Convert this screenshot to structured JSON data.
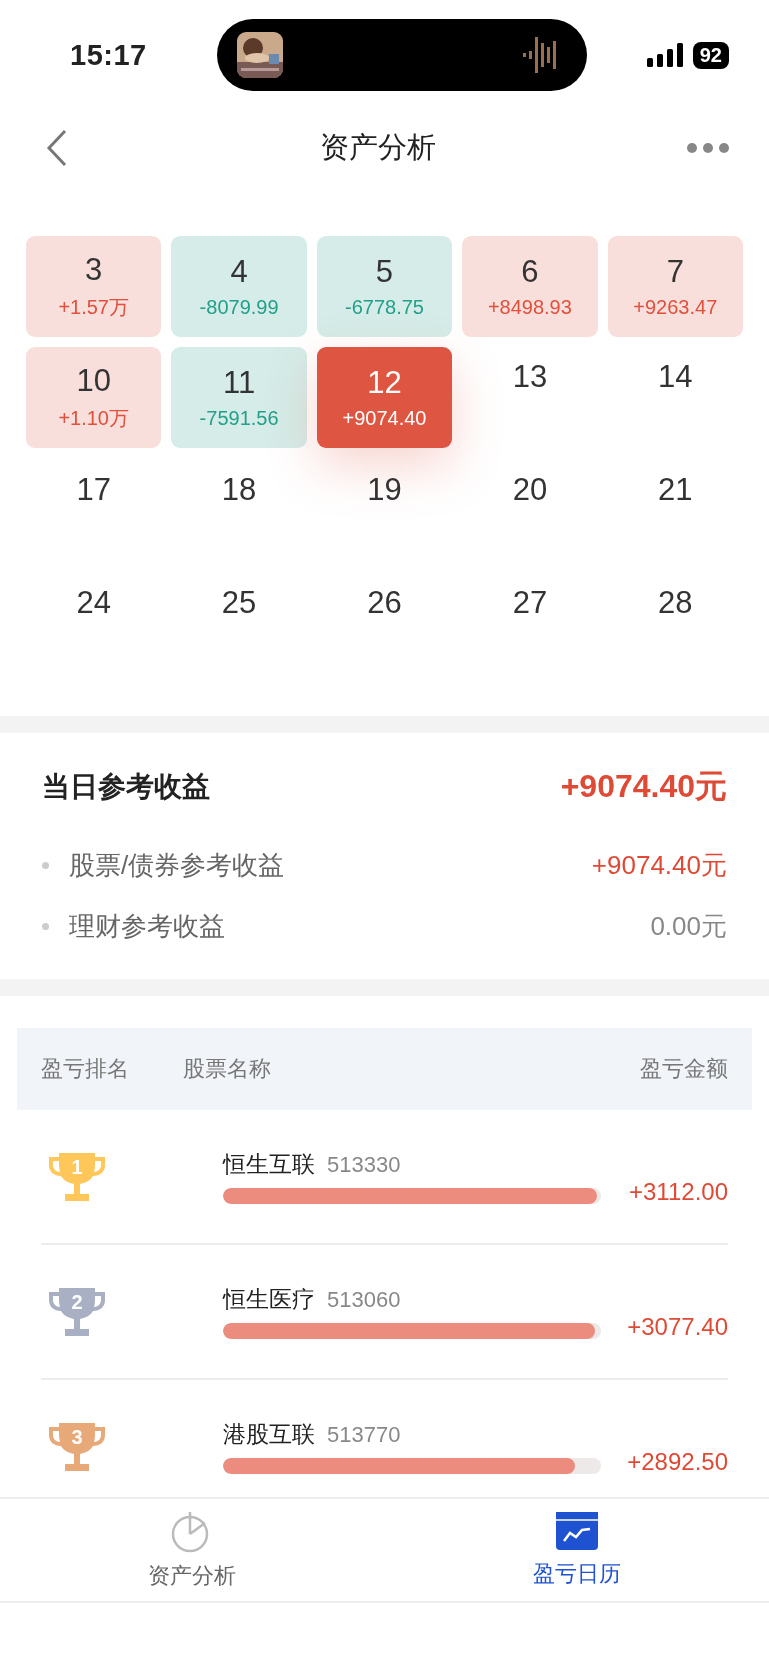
{
  "status_bar": {
    "time": "15:17",
    "battery": "92"
  },
  "nav": {
    "title": "资产分析"
  },
  "calendar": {
    "weeks": [
      [
        {
          "day": "3",
          "amount": "+1.57万",
          "kind": "gain",
          "selected": false
        },
        {
          "day": "4",
          "amount": "-8079.99",
          "kind": "loss",
          "selected": false
        },
        {
          "day": "5",
          "amount": "-6778.75",
          "kind": "loss",
          "selected": false
        },
        {
          "day": "6",
          "amount": "+8498.93",
          "kind": "gain",
          "selected": false
        },
        {
          "day": "7",
          "amount": "+9263.47",
          "kind": "gain",
          "selected": false
        }
      ],
      [
        {
          "day": "10",
          "amount": "+1.10万",
          "kind": "gain",
          "selected": false
        },
        {
          "day": "11",
          "amount": "-7591.56",
          "kind": "loss",
          "selected": false
        },
        {
          "day": "12",
          "amount": "+9074.40",
          "kind": "gain",
          "selected": true
        },
        {
          "day": "13",
          "kind": "none",
          "selected": false
        },
        {
          "day": "14",
          "kind": "none",
          "selected": false
        }
      ],
      [
        {
          "day": "17",
          "kind": "none",
          "selected": false
        },
        {
          "day": "18",
          "kind": "none",
          "selected": false
        },
        {
          "day": "19",
          "kind": "none",
          "selected": false
        },
        {
          "day": "20",
          "kind": "none",
          "selected": false
        },
        {
          "day": "21",
          "kind": "none",
          "selected": false
        }
      ],
      [
        {
          "day": "24",
          "kind": "none",
          "selected": false
        },
        {
          "day": "25",
          "kind": "none",
          "selected": false
        },
        {
          "day": "26",
          "kind": "none",
          "selected": false
        },
        {
          "day": "27",
          "kind": "none",
          "selected": false
        },
        {
          "day": "28",
          "kind": "none",
          "selected": false
        }
      ]
    ]
  },
  "summary": {
    "title": "当日参考收益",
    "total": "+9074.40元",
    "items": [
      {
        "label": "股票/债券参考收益",
        "value": "+9074.40元",
        "kind": "gain"
      },
      {
        "label": "理财参考收益",
        "value": "0.00元",
        "kind": "zero"
      }
    ]
  },
  "ranking": {
    "columns": [
      "盈亏排名",
      "股票名称",
      "盈亏金额"
    ],
    "rows": [
      {
        "rank": "1",
        "color": "#ffc65a",
        "name": "恒生互联",
        "code": "513330",
        "level": 0.99,
        "amount": "+3112.00"
      },
      {
        "rank": "2",
        "color": "#a9b0c4",
        "name": "恒生医疗",
        "code": "513060",
        "level": 0.985,
        "amount": "+3077.40"
      },
      {
        "rank": "3",
        "color": "#e8a979",
        "name": "港股互联",
        "code": "513770",
        "level": 0.93,
        "amount": "+2892.50"
      }
    ]
  },
  "tab_bar": [
    {
      "label": "资产分析",
      "selected": false
    },
    {
      "label": "盈亏日历",
      "selected": true
    }
  ]
}
